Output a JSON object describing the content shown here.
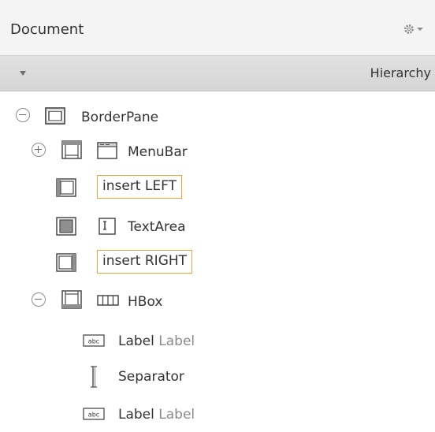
{
  "header": {
    "title": "Document",
    "settings_icon": "gear-icon"
  },
  "hierarchy_bar": {
    "title": "Hierarchy",
    "collapse_icon": "triangle-down-icon"
  },
  "tree": {
    "root": {
      "label": "BorderPane",
      "icon": "borderpane-icon",
      "toggle": "collapse"
    },
    "menubar": {
      "label": "MenuBar",
      "icon": "menubar-icon",
      "toggle": "expand"
    },
    "insert_left": {
      "label": "insert LEFT",
      "accent": "#f1a33a"
    },
    "textarea": {
      "label": "TextArea",
      "icon": "textarea-icon"
    },
    "insert_right": {
      "label": "insert RIGHT",
      "accent": "#f1a33a"
    },
    "hbox": {
      "label": "HBox",
      "icon": "hbox-icon",
      "toggle": "collapse"
    },
    "label1": {
      "type": "Label",
      "text": "Label",
      "icon": "label-icon"
    },
    "separator": {
      "label": "Separator",
      "icon": "separator-icon"
    },
    "label2": {
      "type": "Label",
      "text": "Label",
      "icon": "label-icon"
    }
  }
}
